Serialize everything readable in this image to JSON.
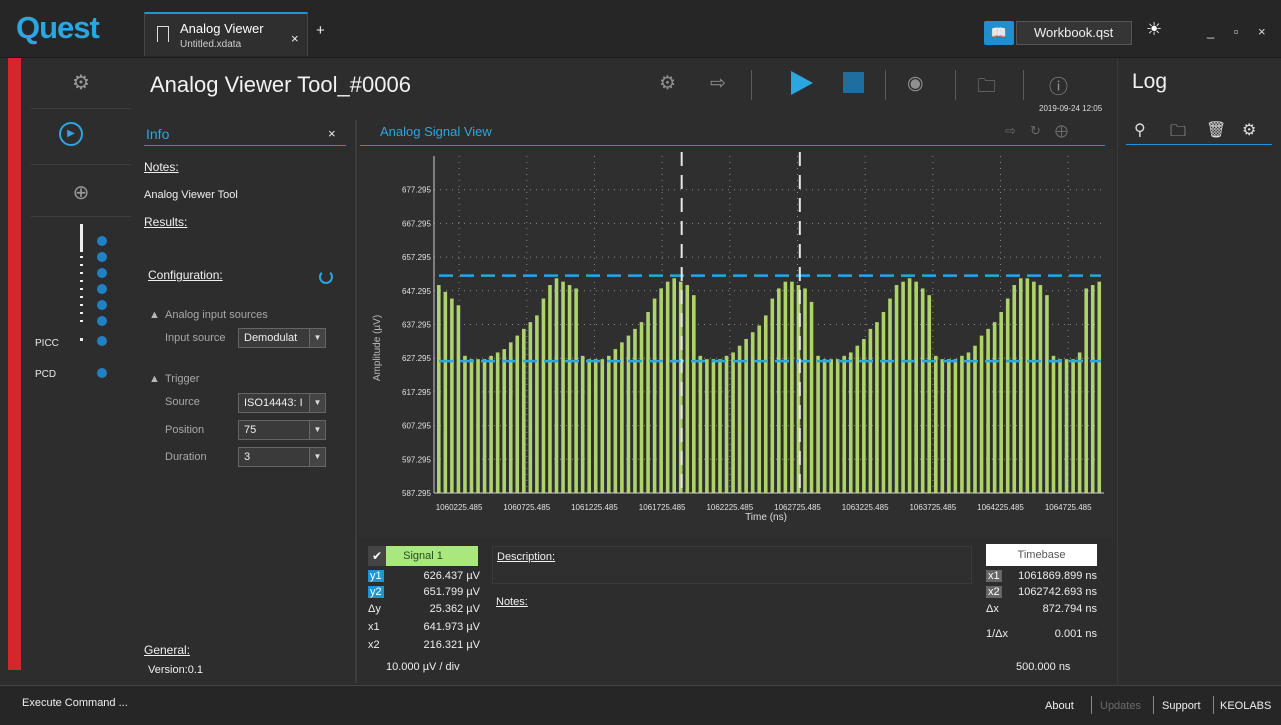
{
  "app": {
    "logo": "Quest",
    "tab": {
      "title": "Analog Viewer",
      "subtitle": "Untitled.xdata",
      "close": "×"
    },
    "new_tab": "+",
    "workbook": "Workbook.qst",
    "window_controls": "_ ▫ ×"
  },
  "sidebar": {
    "labels": {
      "picc": "PICC",
      "pcd": "PCD"
    },
    "icons": [
      "gear-icon",
      "play-circle-icon",
      "target-icon"
    ]
  },
  "header": {
    "title": "Analog Viewer Tool_#0006",
    "timestamp": "2019-09-24 12:05",
    "icons": [
      "settings-gear-icon",
      "export-icon",
      "play-icon",
      "stop-icon",
      "eye-icon",
      "folder-icon",
      "help-icon"
    ]
  },
  "info": {
    "header": "Info",
    "close": "×",
    "notes_label": "Notes:",
    "notes_value": "Analog Viewer Tool",
    "results_label": "Results:",
    "config_label": "Configuration:",
    "analog_sources": "Analog input sources",
    "input_source_label": "Input source",
    "input_source_value": "Demodulat",
    "trigger": "Trigger",
    "source_label": "Source",
    "source_value": "ISO14443: I",
    "position_label": "Position",
    "position_value": "75",
    "duration_label": "Duration",
    "duration_value": "3",
    "general_label": "General:",
    "version": "Version:0.1"
  },
  "signal_view": {
    "header": "Analog Signal View"
  },
  "chart_data": {
    "type": "bar",
    "xlabel": "Time (ns)",
    "ylabel": "Amplitude (µV)",
    "x_ticks": [
      "1060225.485",
      "1060725.485",
      "1061225.485",
      "1061725.485",
      "1062225.485",
      "1062725.485",
      "1063225.485",
      "1063725.485",
      "1064225.485",
      "1064725.485"
    ],
    "y_ticks": [
      "587.295",
      "597.295",
      "607.295",
      "617.295",
      "627.295",
      "637.295",
      "647.295",
      "657.295",
      "667.295",
      "677.295"
    ],
    "ylim": [
      587.295,
      687.295
    ],
    "xlim": [
      1060040,
      1064990
    ],
    "baseline": 587.295,
    "series": [
      {
        "color": "#b4dc6e",
        "values": [
          649,
          647,
          645,
          643,
          628,
          627,
          627,
          627,
          628,
          629,
          630,
          632,
          634,
          636,
          638,
          640,
          645,
          649,
          651,
          650,
          649,
          648,
          628,
          627,
          627,
          627,
          628,
          630,
          632,
          634,
          636,
          638,
          641,
          645,
          648,
          650,
          651,
          650,
          649,
          646,
          628,
          627,
          627,
          627,
          628,
          629,
          631,
          633,
          635,
          637,
          640,
          645,
          648,
          650,
          650,
          649,
          648,
          644,
          628,
          627,
          627,
          627,
          628,
          629,
          631,
          633,
          636,
          638,
          641,
          645,
          649,
          650,
          651,
          650,
          648,
          646,
          628,
          627,
          627,
          627,
          628,
          629,
          631,
          634,
          636,
          638,
          641,
          645,
          649,
          651,
          651,
          650,
          649,
          646,
          628,
          627,
          627,
          627,
          629,
          648,
          649,
          650
        ]
      }
    ],
    "cursors": {
      "y1": 626.437,
      "y2": 651.799,
      "x1_time": 1061869.899,
      "x2_time": 1062742.693
    },
    "grid": true
  },
  "measurements": {
    "signal_name": "Signal 1",
    "rows": [
      {
        "key": "y1",
        "value": "626.437 µV"
      },
      {
        "key": "y2",
        "value": "651.799 µV"
      },
      {
        "key": "Δy",
        "value": "25.362 µV"
      },
      {
        "key": "x1",
        "value": "641.973 µV"
      },
      {
        "key": "x2",
        "value": "216.321 µV"
      }
    ],
    "scale": "10.000 µV / div",
    "description_label": "Description:",
    "notes_label": "Notes:"
  },
  "timebase": {
    "header": "Timebase",
    "rows": [
      {
        "key": "x1",
        "value": "1061869.899 ns"
      },
      {
        "key": "x2",
        "value": "1062742.693 ns"
      },
      {
        "key": "Δx",
        "value": "872.794 ns"
      },
      {
        "key": "1/Δx",
        "value": "0.001 ns"
      }
    ],
    "scale": "500.000 ns"
  },
  "log": {
    "title": "Log"
  },
  "status": {
    "execute": "Execute Command ...",
    "about": "About",
    "updates": "Updates",
    "support": "Support",
    "brand": "KEOLABS"
  }
}
